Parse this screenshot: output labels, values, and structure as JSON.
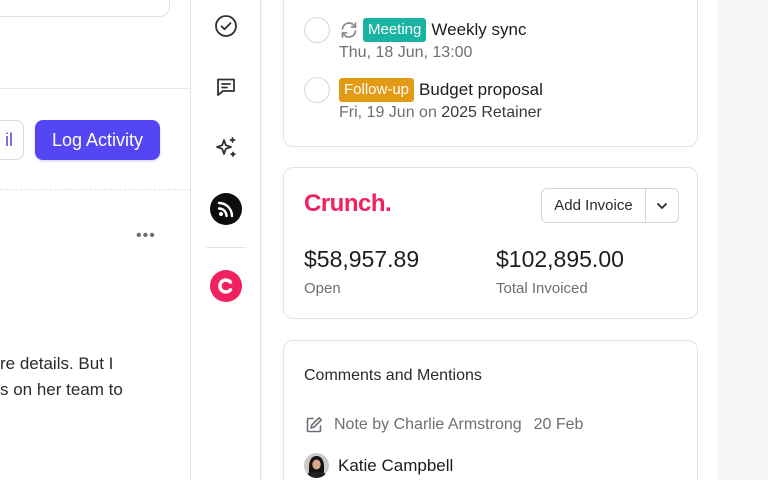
{
  "left": {
    "email_button_label": "il",
    "log_activity_label": "Log Activity",
    "more_label": "•••",
    "text_lines": [
      "re details. But I",
      "s on her team to"
    ]
  },
  "rail": {
    "icons": [
      "check-circle-icon",
      "message-icon",
      "sparkles-icon",
      "rss-icon",
      "crunch-app-icon"
    ]
  },
  "tasks": [
    {
      "badge": "Meeting",
      "badge_color": "#19b3a2",
      "title": "Weekly sync",
      "date": "Thu, 18 Jun, 13:00",
      "icon": "recurring-icon"
    },
    {
      "badge": "Follow-up",
      "badge_color": "#e39a14",
      "title": "Budget proposal",
      "date": "Fri, 19 Jun",
      "connector": "on",
      "related": "2025 Retainer"
    }
  ],
  "crunch": {
    "logo": "Crunch.",
    "brand_color": "#f0215e",
    "add_invoice_label": "Add Invoice",
    "open_amount": "$58,957.89",
    "open_label": "Open",
    "total_amount": "$102,895.00",
    "total_label": "Total Invoiced"
  },
  "comments": {
    "title": "Comments and Mentions",
    "note_label": "Note by Charlie Armstrong",
    "note_date": "20 Feb",
    "person_name": "Katie Campbell"
  }
}
